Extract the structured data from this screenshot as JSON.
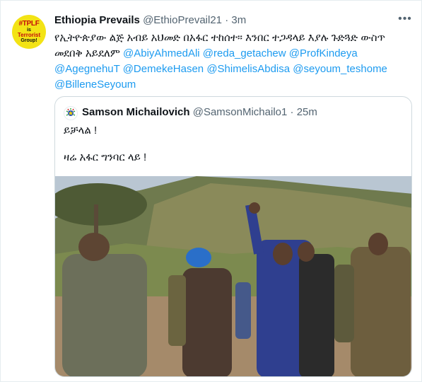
{
  "tweet": {
    "display_name": "Ethiopia Prevails",
    "handle": "@EthioPrevail21",
    "separator": "·",
    "time": "3m",
    "more_icon": "more-horizontal-icon",
    "text_amharic": "የኢትዮጵያው ልጅ አብይ አህመድ በአፋር ተከሰተ። እንበር ተጋዳላይ እያሉ ጉድጓድ ውስጥ መደበቅ አይደለም",
    "mentions": [
      "@AbiyAhmedAli",
      "@reda_getachew",
      "@ProfKindeya",
      "@AgegnehuT",
      "@DemekeHasen",
      "@ShimelisAbdisa",
      "@seyoum_teshome",
      "@BilleneSeyoum"
    ],
    "avatar": {
      "line1": "#TPLF",
      "line2": "is",
      "line3": "Terrorist",
      "line4": "Group!"
    }
  },
  "quote": {
    "display_name": "Samson Michailovich",
    "handle": "@SamsonMichailo1",
    "separator": "·",
    "time": "25m",
    "line1": "ይቻላል !",
    "line2": "ዛሬ አፋር ግንባር ላይ !"
  },
  "colors": {
    "link": "#1d9bf0",
    "muted": "#536471",
    "border": "#cfd9de",
    "avatar_bg": "#f3e315"
  }
}
